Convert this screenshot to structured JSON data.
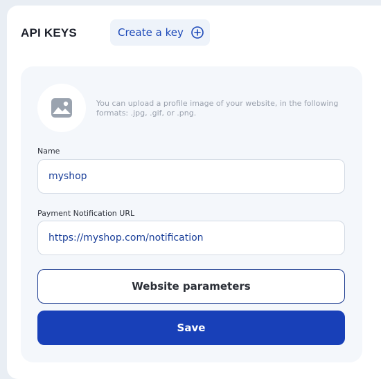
{
  "header": {
    "title": "API KEYS",
    "create_key_label": "Create a key",
    "create_key_icon": "plus-circle-icon"
  },
  "profile_image": {
    "icon": "image-icon",
    "hint": "You can upload a profile image of your website, in the following formats: .jpg, .gif, or .png."
  },
  "form": {
    "name_label": "Name",
    "name_value": "myshop",
    "url_label": "Payment Notification URL",
    "url_value": "https://myshop.com/notification",
    "params_button": "Website parameters",
    "save_button": "Save"
  },
  "colors": {
    "accent": "#1840b8",
    "link_text": "#1a47b8",
    "card_bg": "#f4f7fb"
  }
}
